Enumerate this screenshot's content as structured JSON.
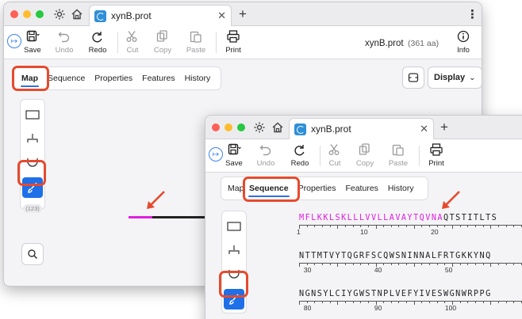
{
  "window1": {
    "tab_title": "xynB.prot",
    "toolbar": {
      "save": "Save",
      "undo": "Undo",
      "redo": "Redo",
      "cut": "Cut",
      "copy": "Copy",
      "paste": "Paste",
      "print": "Print",
      "info": "Info"
    },
    "filename": "xynB.prot",
    "filesize": "(361 aa)",
    "tabs": [
      "Map",
      "Sequence",
      "Properties",
      "Features",
      "History"
    ],
    "active_tab": "Map",
    "display_label": "Display",
    "tool_badge": "(123)"
  },
  "window2": {
    "tab_title": "xynB.prot",
    "toolbar": {
      "save": "Save",
      "undo": "Undo",
      "redo": "Redo",
      "cut": "Cut",
      "copy": "Copy",
      "paste": "Paste",
      "print": "Print"
    },
    "tabs": [
      "Map",
      "Sequence",
      "Properties",
      "Features",
      "History"
    ],
    "active_tab": "Sequence",
    "sequence_lines": [
      {
        "highlighted": "MFLKKLSKLLLVVLLAVAYTQVNA",
        "rest": "QTSTITLTS",
        "ticks": [
          "1",
          "10",
          "20"
        ]
      },
      {
        "highlighted": "",
        "rest": "NTTMTVYTQGRFSCQWSNINNALFRTGKKYNQ",
        "ticks": [
          "30",
          "40",
          "50"
        ]
      },
      {
        "highlighted": "",
        "rest": "NGNSYLCIYGWSTNPLVEFYIVESWGNWRPPG",
        "ticks": [
          "80",
          "90",
          "100"
        ]
      }
    ]
  },
  "colors": {
    "highlight": "#e01ee0",
    "callout": "#e64a2e",
    "accent": "#1f6fe8"
  }
}
